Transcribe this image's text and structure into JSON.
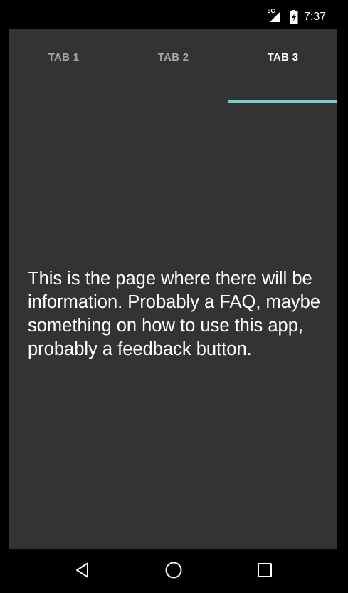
{
  "status_bar": {
    "network_label": "3G",
    "time": "7:37",
    "icons": [
      "signal-icon",
      "battery-icon"
    ]
  },
  "tabs": [
    {
      "label": "TAB 1",
      "active": false
    },
    {
      "label": "TAB 2",
      "active": false
    },
    {
      "label": "TAB 3",
      "active": true
    }
  ],
  "content": {
    "text": "This is the page where there will be information. Probably a FAQ, maybe something on how to use this app, probably a feedback button."
  },
  "nav_bar": {
    "icons": [
      "back-icon",
      "home-icon",
      "recents-icon"
    ]
  },
  "colors": {
    "accent": "#74d0cb",
    "background": "#333333",
    "inactive_tab": "#a6a6a6"
  }
}
